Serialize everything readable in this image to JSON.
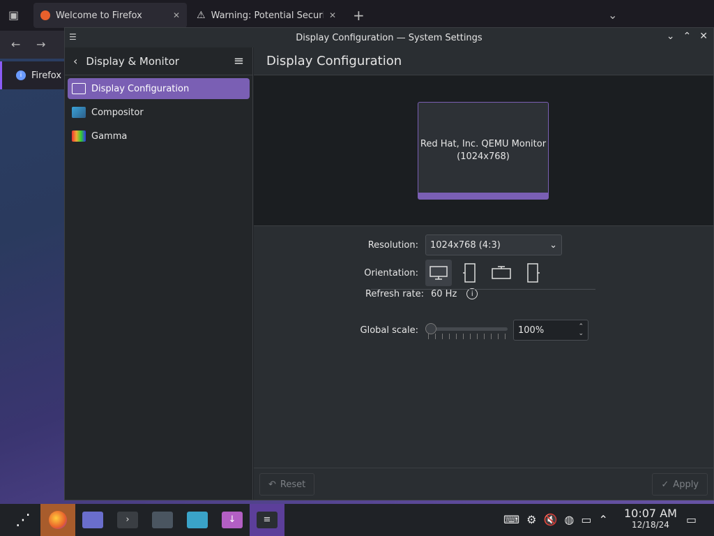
{
  "firefox": {
    "tabs": [
      {
        "label": "Welcome to Firefox"
      },
      {
        "label": "Warning: Potential Securit"
      }
    ],
    "notification_label": "Firefox"
  },
  "window": {
    "title": "Display Configuration — System Settings"
  },
  "sidebar": {
    "header": "Display & Monitor",
    "items": [
      {
        "label": "Display Configuration"
      },
      {
        "label": "Compositor"
      },
      {
        "label": "Gamma"
      }
    ]
  },
  "content": {
    "title": "Display Configuration",
    "monitor": {
      "name": "Red Hat, Inc. QEMU Monitor",
      "resolution": "(1024x768)"
    },
    "resolution": {
      "label": "Resolution:",
      "value": "1024x768 (4:3)"
    },
    "orientation": {
      "label": "Orientation:"
    },
    "refresh": {
      "label": "Refresh rate:",
      "value": "60 Hz"
    },
    "scale": {
      "label": "Global scale:",
      "value": "100%",
      "slider_level": 0
    }
  },
  "footer": {
    "reset": "Reset",
    "apply": "Apply"
  },
  "taskbar": {
    "time": "10:07 AM",
    "date": "12/18/24"
  },
  "colors": {
    "accent": "#7a5fb4",
    "window_bg": "#2a2e32",
    "sidebar_bg": "#232629"
  }
}
